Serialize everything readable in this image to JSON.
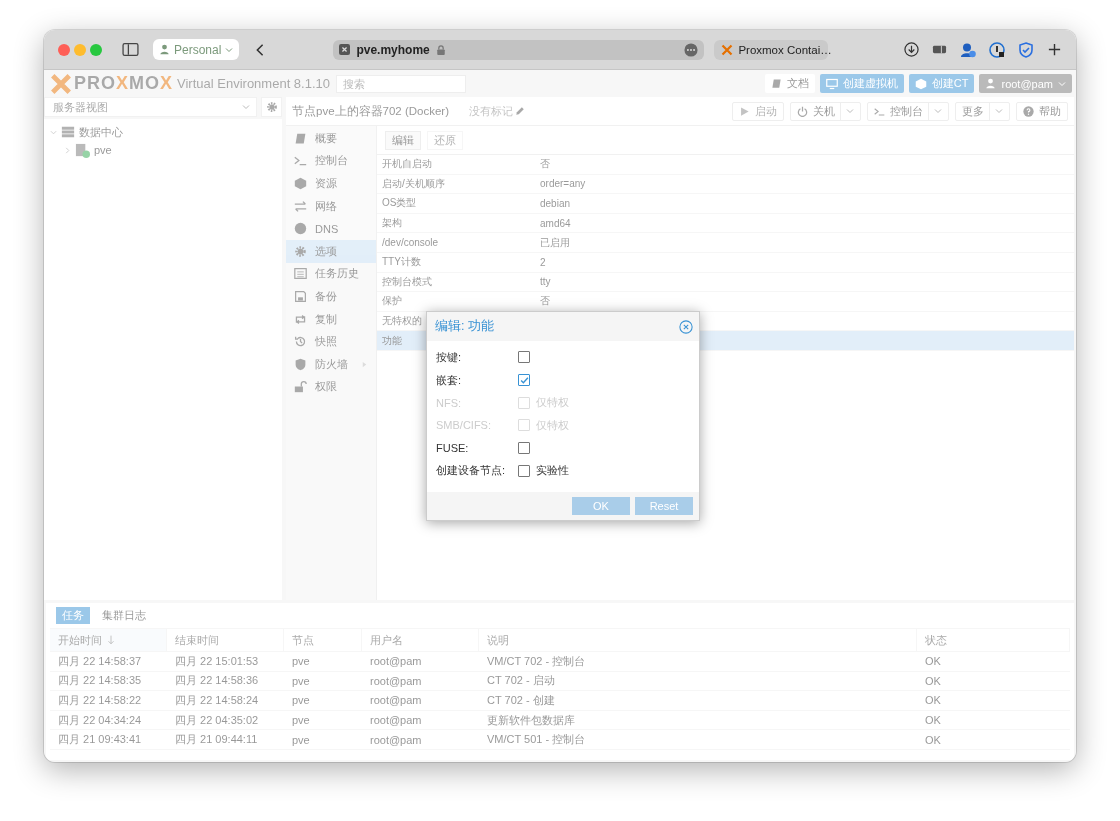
{
  "browser": {
    "profile": "Personal",
    "address": "pve.myhome",
    "tab": "Proxmox Contai…"
  },
  "header": {
    "logo": "PRO**X**MO**X**",
    "product": "Virtual Environment 8.1.10",
    "search": {
      "placeholder": "搜索"
    },
    "buttons": [
      {
        "label": "文档",
        "kind": "docs"
      },
      {
        "label": "创建虚拟机",
        "kind": "vm"
      },
      {
        "label": "创建CT",
        "kind": "ct"
      },
      {
        "label": "root@pam",
        "kind": "user"
      }
    ]
  },
  "sidebar": {
    "view": "服务器视图",
    "tree": [
      {
        "label": "数据中心",
        "kind": "datacenter",
        "expanded": true,
        "children": [
          {
            "label": "pve",
            "kind": "node",
            "expanded": false
          }
        ]
      }
    ]
  },
  "panel": {
    "title": "节点pve上的容器702 (Docker)",
    "tags": "没有标记",
    "actions": [
      {
        "label": "启动",
        "kind": "start",
        "disabled": true,
        "dropdown": false
      },
      {
        "label": "关机",
        "kind": "shutdown",
        "disabled": false,
        "dropdown": true
      },
      {
        "label": "控制台",
        "kind": "console",
        "disabled": false,
        "dropdown": true
      },
      {
        "label": "更多",
        "kind": "more",
        "disabled": false,
        "dropdown": true
      },
      {
        "label": "帮助",
        "kind": "help",
        "disabled": false,
        "dropdown": false
      }
    ],
    "nav": [
      {
        "label": "概要",
        "kind": "summary",
        "selected": false,
        "expandable": false
      },
      {
        "label": "控制台",
        "kind": "console",
        "selected": false,
        "expandable": false
      },
      {
        "label": "资源",
        "kind": "resources",
        "selected": false,
        "expandable": false
      },
      {
        "label": "网络",
        "kind": "network",
        "selected": false,
        "expandable": false
      },
      {
        "label": "DNS",
        "kind": "dns",
        "selected": false,
        "expandable": false
      },
      {
        "label": "选项",
        "kind": "options",
        "selected": true,
        "expandable": false
      },
      {
        "label": "任务历史",
        "kind": "history",
        "selected": false,
        "expandable": false
      },
      {
        "label": "备份",
        "kind": "backup",
        "selected": false,
        "expandable": false
      },
      {
        "label": "复制",
        "kind": "replication",
        "selected": false,
        "expandable": false
      },
      {
        "label": "快照",
        "kind": "snapshot",
        "selected": false,
        "expandable": false
      },
      {
        "label": "防火墙",
        "kind": "firewall",
        "selected": false,
        "expandable": true
      },
      {
        "label": "权限",
        "kind": "permissions",
        "selected": false,
        "expandable": false
      }
    ],
    "toolbar": [
      {
        "label": "编辑",
        "disabled": false
      },
      {
        "label": "还原",
        "disabled": true
      }
    ],
    "rows": [
      {
        "name": "开机自启动",
        "value": "否",
        "selected": false
      },
      {
        "name": "启动/关机顺序",
        "value": "order=any",
        "selected": false
      },
      {
        "name": "OS类型",
        "value": "debian",
        "selected": false
      },
      {
        "name": "架构",
        "value": "amd64",
        "selected": false
      },
      {
        "name": "/dev/console",
        "value": "已启用",
        "selected": false
      },
      {
        "name": "TTY计数",
        "value": "2",
        "selected": false
      },
      {
        "name": "控制台模式",
        "value": "tty",
        "selected": false
      },
      {
        "name": "保护",
        "value": "否",
        "selected": false
      },
      {
        "name": "无特权的",
        "selected": false
      },
      {
        "name": "功能",
        "selected": true
      }
    ]
  },
  "dialog": {
    "title": "编辑: 功能",
    "fields": [
      {
        "label": "按键:",
        "checked": false,
        "disabled": false
      },
      {
        "label": "嵌套:",
        "checked": true,
        "disabled": false
      },
      {
        "label": "NFS:",
        "checked": false,
        "disabled": true,
        "note": "仅特权"
      },
      {
        "label": "SMB/CIFS:",
        "checked": false,
        "disabled": true,
        "note": "仅特权"
      },
      {
        "label": "FUSE:",
        "checked": false,
        "disabled": false
      },
      {
        "label": "创建设备节点:",
        "checked": false,
        "disabled": false,
        "note": "实验性"
      }
    ],
    "buttons": [
      {
        "label": "OK",
        "disabled": true
      },
      {
        "label": "Reset",
        "disabled": true
      }
    ]
  },
  "tasks": {
    "tabs": [
      {
        "label": "任务",
        "selected": true
      },
      {
        "label": "集群日志",
        "selected": false
      }
    ],
    "columns": [
      {
        "label": "开始时间",
        "sorted": true
      },
      {
        "label": "结束时间",
        "sorted": false
      },
      {
        "label": "节点",
        "sorted": false
      },
      {
        "label": "用户名",
        "sorted": false
      },
      {
        "label": "说明",
        "sorted": false
      },
      {
        "label": "状态",
        "sorted": false
      }
    ],
    "rows": [
      [
        "四月 22 14:58:37",
        "四月 22 15:01:53",
        "pve",
        "root@pam",
        "VM/CT 702 - 控制台",
        "OK"
      ],
      [
        "四月 22 14:58:35",
        "四月 22 14:58:36",
        "pve",
        "root@pam",
        "CT 702 - 启动",
        "OK"
      ],
      [
        "四月 22 14:58:22",
        "四月 22 14:58:24",
        "pve",
        "root@pam",
        "CT 702 - 创建",
        "OK"
      ],
      [
        "四月 22 04:34:24",
        "四月 22 04:35:02",
        "pve",
        "root@pam",
        "更新软件包数据库",
        "OK"
      ],
      [
        "四月 21 09:43:41",
        "四月 21 09:44:11",
        "pve",
        "root@pam",
        "VM/CT 501 - 控制台",
        "OK"
      ]
    ]
  }
}
